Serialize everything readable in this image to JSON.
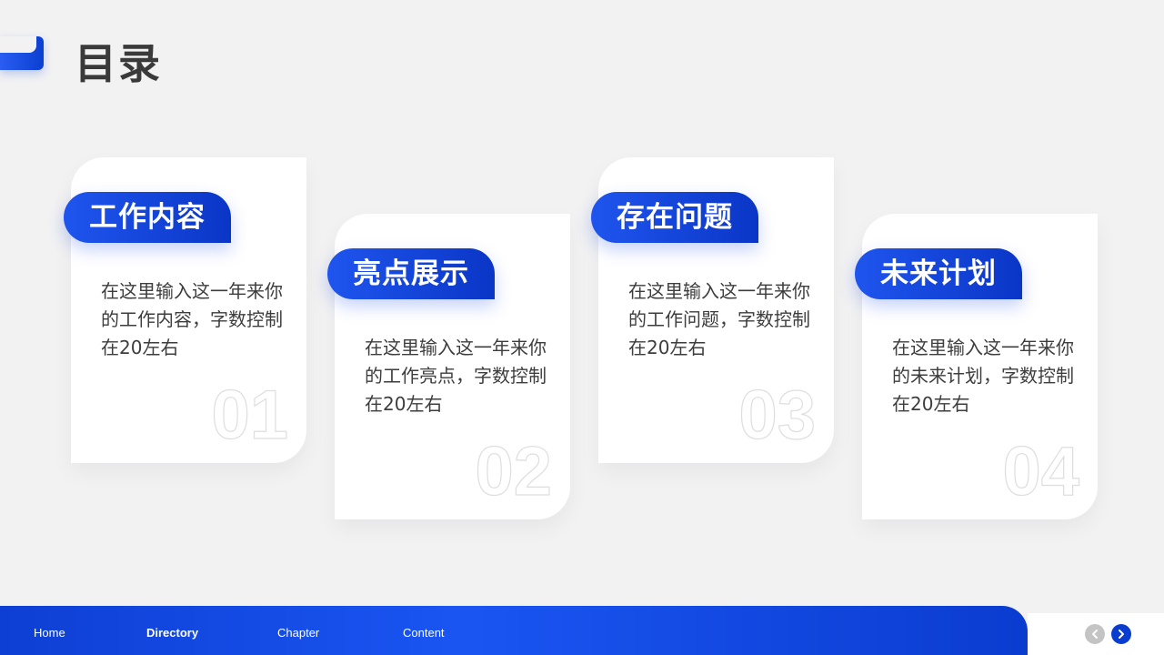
{
  "title": "目录",
  "cards": [
    {
      "tag": "工作内容",
      "text": "在这里输入这一年来你的工作内容，字数控制在20左右",
      "number": "01"
    },
    {
      "tag": "亮点展示",
      "text": "在这里输入这一年来你的工作亮点，字数控制在20左右",
      "number": "02"
    },
    {
      "tag": "存在问题",
      "text": "在这里输入这一年来你的工作问题，字数控制在20左右",
      "number": "03"
    },
    {
      "tag": "未来计划",
      "text": "在这里输入这一年来你的未来计划，字数控制在20左右",
      "number": "04"
    }
  ],
  "nav": {
    "items": [
      "Home",
      "Directory",
      "Chapter",
      "Content"
    ],
    "active": "Directory"
  },
  "icons": {
    "prev": "chevron-left-icon",
    "next": "chevron-right-icon"
  },
  "colors": {
    "accent": "#1a55f2",
    "accent_dark": "#0a36c6",
    "background": "#f2f2f3",
    "text": "#3d3d3d"
  }
}
